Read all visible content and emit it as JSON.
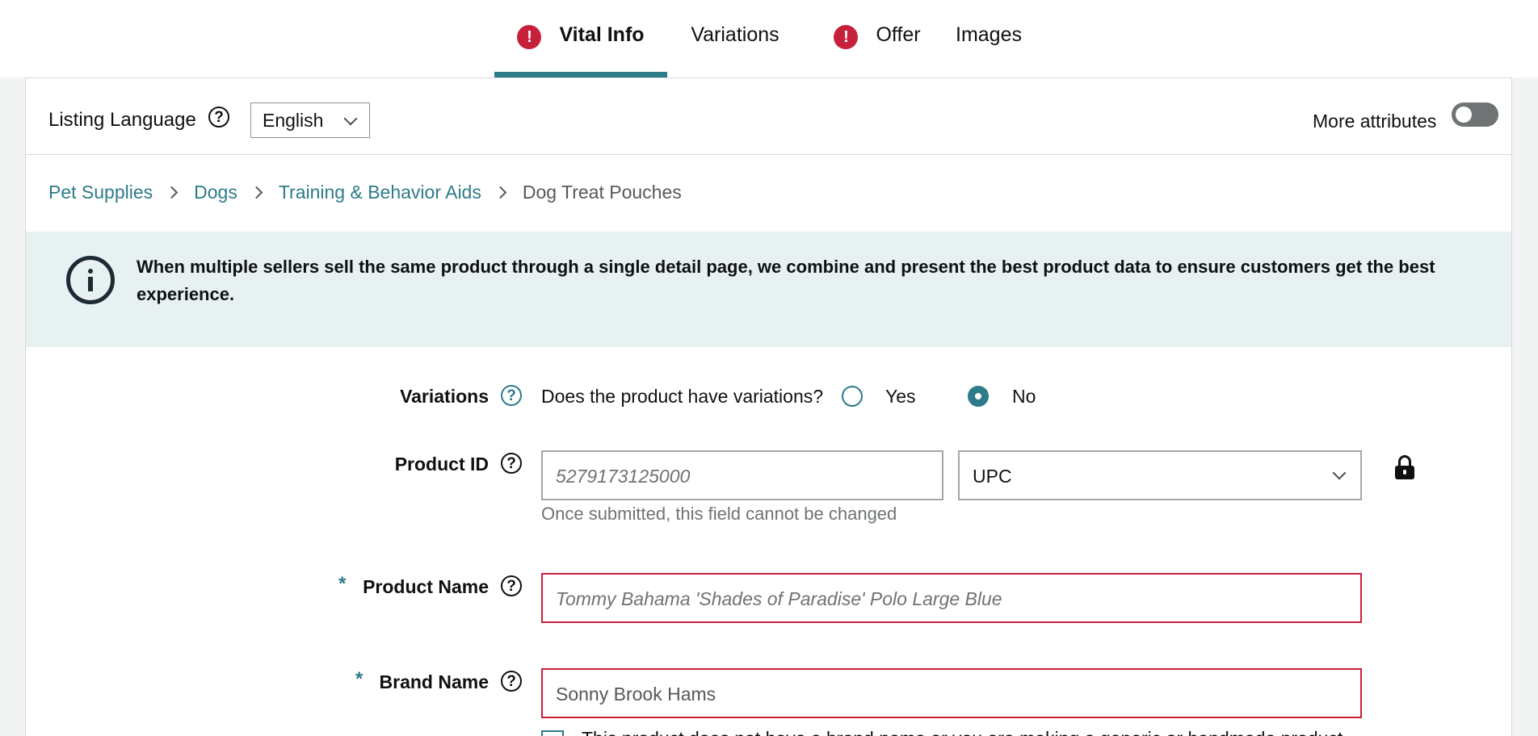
{
  "tabs": [
    {
      "label": "Vital Info",
      "alert": true,
      "active": true
    },
    {
      "label": "Variations",
      "alert": false,
      "active": false
    },
    {
      "label": "Offer",
      "alert": true,
      "active": false
    },
    {
      "label": "Images",
      "alert": false,
      "active": false
    }
  ],
  "header": {
    "listing_language_label": "Listing Language",
    "language_value": "English",
    "more_attributes_label": "More attributes",
    "more_attributes_on": false
  },
  "breadcrumb": [
    "Pet Supplies",
    "Dogs",
    "Training & Behavior Aids",
    "Dog Treat Pouches"
  ],
  "banner": {
    "text": "When multiple sellers sell the same product through a single detail page, we combine and present the best product data to ensure customers get the best experience."
  },
  "form": {
    "variations": {
      "label": "Variations",
      "question": "Does the product have variations?",
      "yes_label": "Yes",
      "no_label": "No",
      "selected": "No"
    },
    "product_id": {
      "label": "Product ID",
      "placeholder": "5279173125000",
      "type_value": "UPC",
      "hint": "Once submitted, this field cannot be changed"
    },
    "product_name": {
      "label": "Product Name",
      "required_mark": "*",
      "placeholder": "Tommy Bahama 'Shades of Paradise' Polo Large Blue"
    },
    "brand_name": {
      "label": "Brand Name",
      "required_mark": "*",
      "value": "Sonny Brook Hams"
    },
    "no_brand_checkbox_label": "This product does not have a brand name or you are making a generic or handmade product"
  },
  "colors": {
    "accent": "#2e7b8a",
    "error": "#c7203a",
    "banner_bg": "#e7f1f2"
  },
  "icons": {
    "tab_alert": "exclamation-circle-icon",
    "help": "question-circle-icon",
    "info": "info-circle-icon",
    "lock": "lock-icon",
    "chevron": "chevron-down-icon"
  }
}
